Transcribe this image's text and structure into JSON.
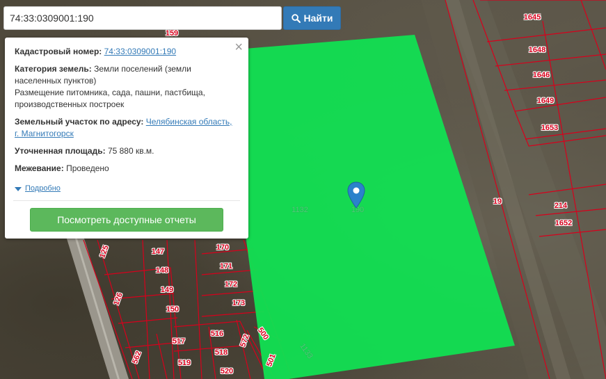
{
  "search": {
    "value": "74:33:0309001:190",
    "button_label": "Найти"
  },
  "popup": {
    "cadastral_label": "Кадастровый номер:",
    "cadastral_value": "74:33:0309001:190",
    "category_label": "Категория земель:",
    "category_value": "Земли поселений (земли населенных пунктов)",
    "usage": "Размещение питомника, сада, пашни, пастбища, производственных построек",
    "address_label": "Земельный участок по адресу:",
    "address_value": "Челябинская область, г. Магнитогорск",
    "area_label": "Уточненная площадь:",
    "area_value": "75 880 кв.м.",
    "survey_label": "Межевание:",
    "survey_value": "Проведено",
    "details_label": "Подробно",
    "reports_button": "Посмотреть доступные отчеты"
  },
  "map": {
    "selected_parcel_color": "#11e052",
    "boundary_color": "#d8001c",
    "labels": [
      "159",
      "1645",
      "1648",
      "1646",
      "1649",
      "1653",
      "19",
      "214",
      "1652",
      "1132",
      "190",
      "1133",
      "125",
      "126",
      "147",
      "148",
      "149",
      "150",
      "170",
      "171",
      "172",
      "173",
      "516",
      "517",
      "518",
      "519",
      "520",
      "500",
      "501",
      "562",
      "572"
    ]
  }
}
